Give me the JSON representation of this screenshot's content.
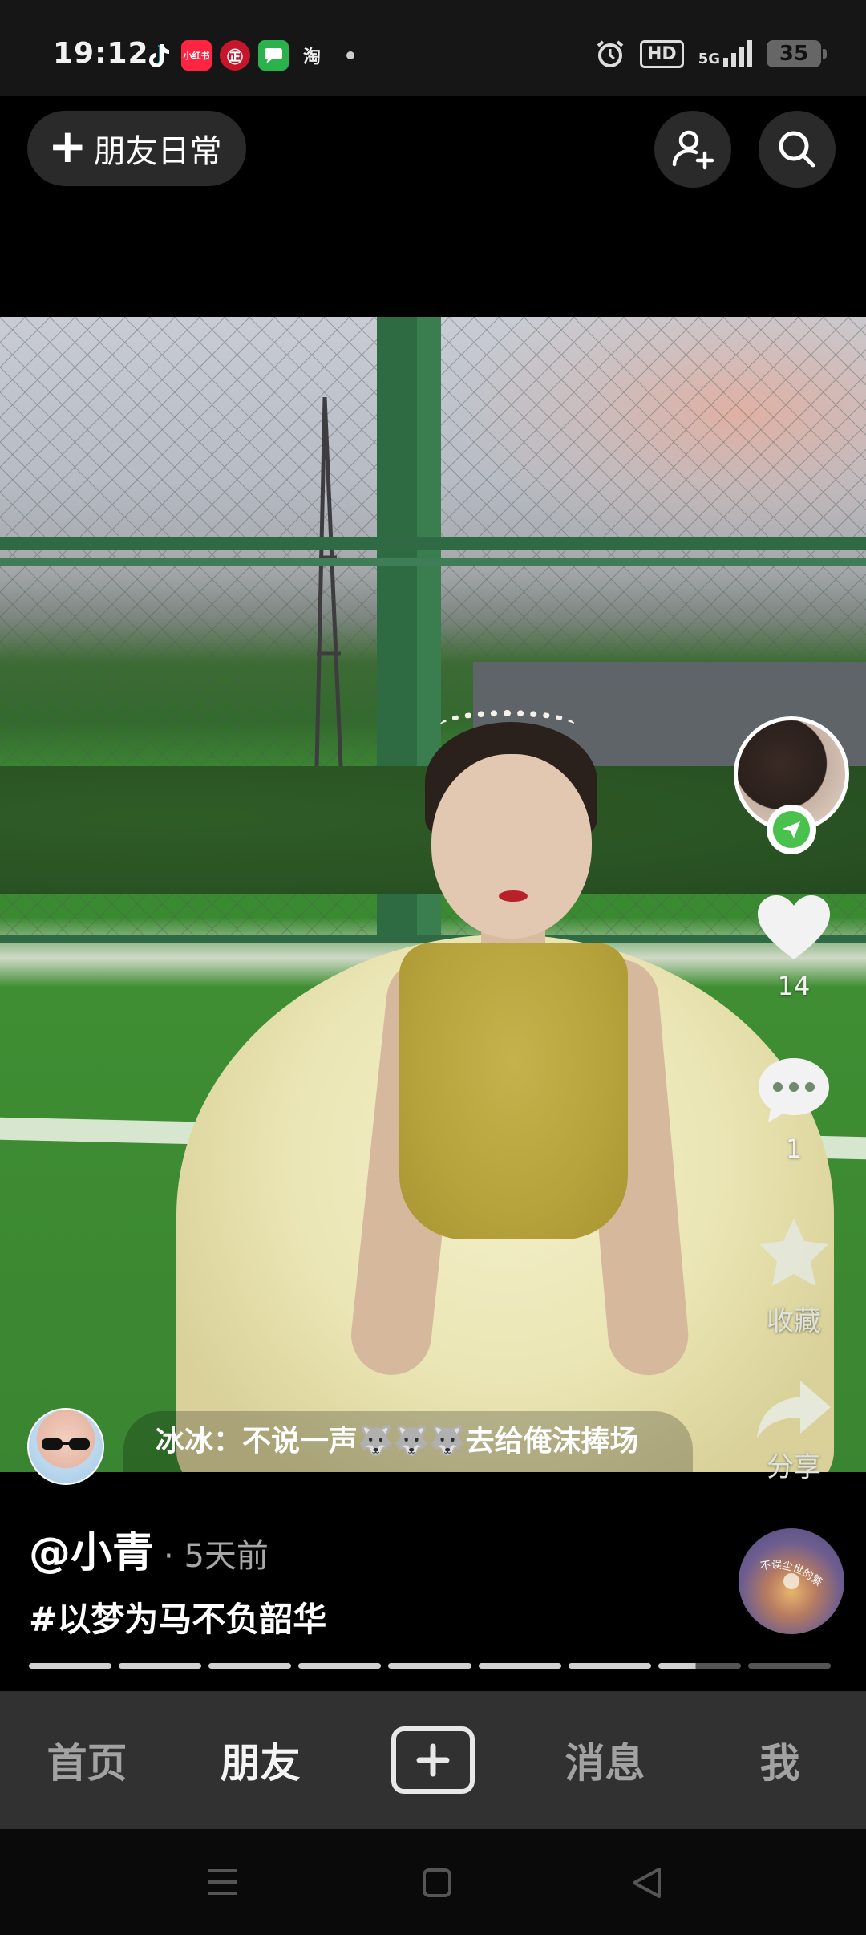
{
  "status_bar": {
    "time": "19:12",
    "notification_icons": [
      "tiktok-icon",
      "xiaohongshu-icon",
      "bank-icon",
      "message-icon",
      "taobao-icon",
      "more-dot"
    ],
    "notif_labels": {
      "xiaohongshu": "小红书",
      "bank": "㊣",
      "taobao": "淘"
    },
    "hd": "HD",
    "network": "5G",
    "battery": "35"
  },
  "top_bar": {
    "daily_button_label": "朋友日常",
    "add_friend_icon": "add-person-icon",
    "search_icon": "search-icon"
  },
  "right_rail": {
    "likes": "14",
    "comments": "1",
    "favorite_label": "收藏",
    "share_label": "分享"
  },
  "comment_preview": {
    "text_before_emoji": "冰冰：不说一声",
    "emojis": "🐺🐺🐺",
    "text_after_emoji": "去给俺沫捧场"
  },
  "caption": {
    "author": "@小青",
    "time_ago": "· 5天前",
    "hashtag": "#以梦为马不负韶华"
  },
  "music_disc_text": "不误尘世的繁华上方",
  "progress": {
    "total_segments": 9,
    "completed": 7,
    "current_fraction": 0.45
  },
  "bottom_nav": {
    "home": "首页",
    "friends": "朋友",
    "create_icon": "plus-box-icon",
    "messages": "消息",
    "me": "我",
    "active": "friends"
  },
  "colors": {
    "background": "#000000",
    "nav_background": "#313131",
    "follow_badge": "#49c24d",
    "muted_text": "#a7a7a7"
  }
}
